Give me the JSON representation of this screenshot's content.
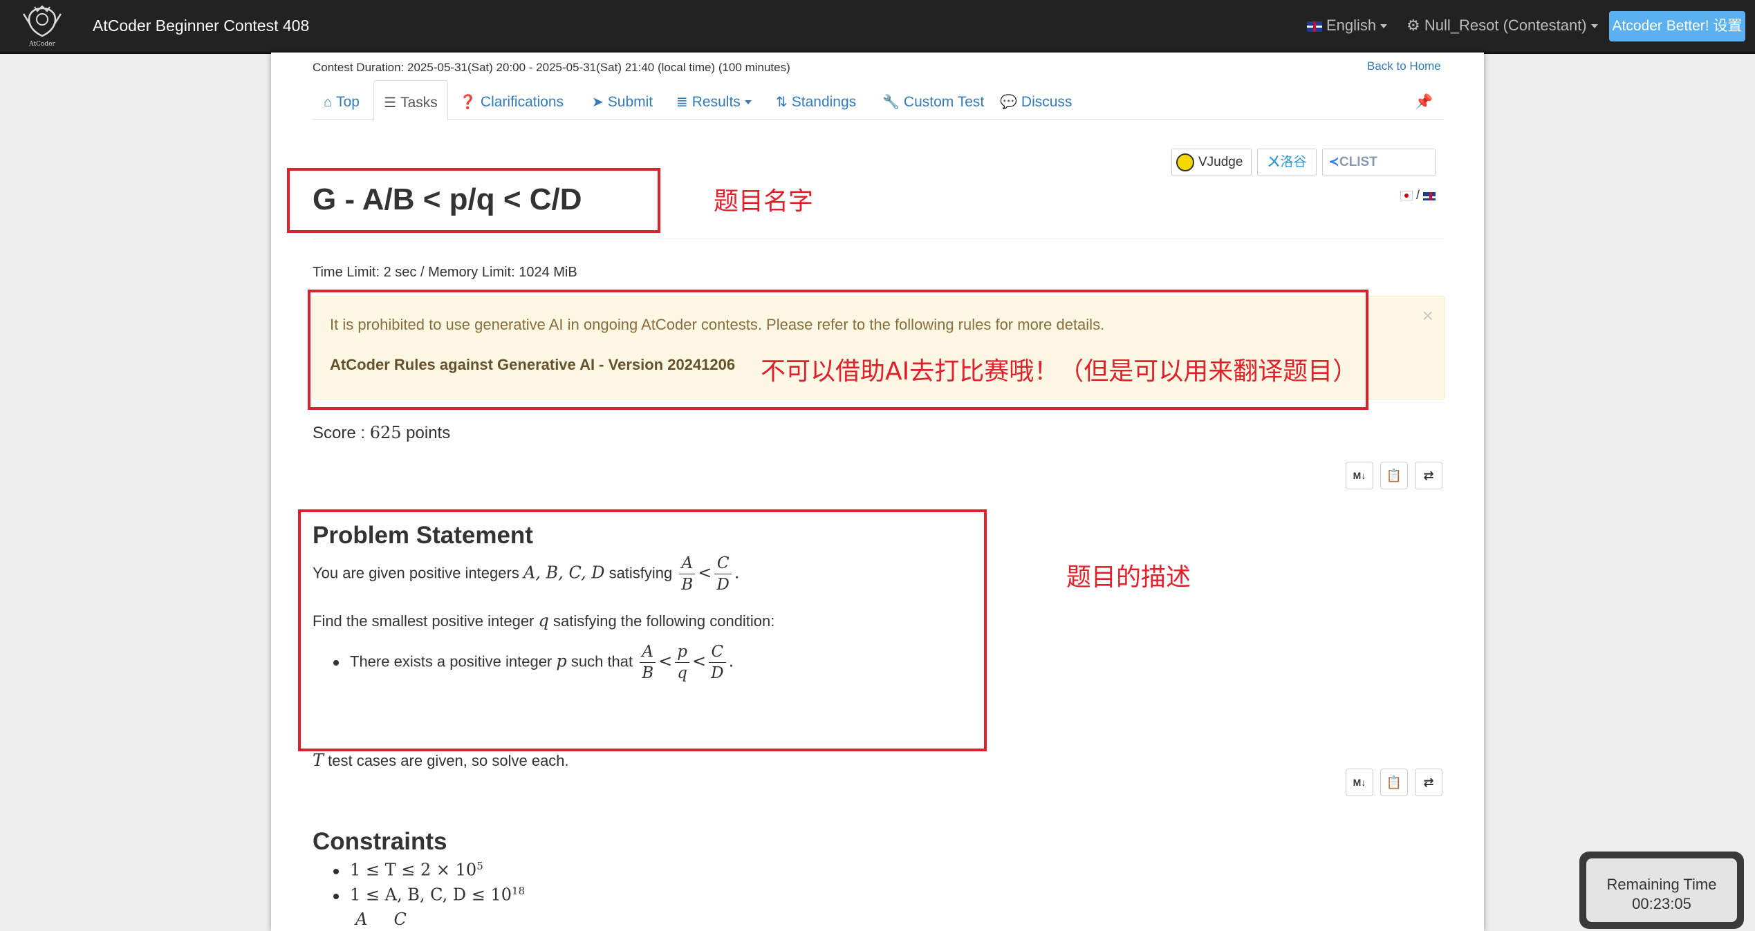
{
  "navbar": {
    "brand": "AtCoder Beginner Contest 408",
    "logo_text": "AtCoder",
    "language": "English",
    "user": "Null_Resot (Contestant)",
    "better_button": "Atcoder Better! 设置"
  },
  "contest": {
    "duration": "Contest Duration: 2025-05-31(Sat) 20:00 - 2025-05-31(Sat) 21:40 (local time) (100 minutes)",
    "back_home": "Back to Home"
  },
  "tabs": [
    {
      "label": "Top",
      "icon": "home-icon"
    },
    {
      "label": "Tasks",
      "icon": "tasks-icon",
      "active": true
    },
    {
      "label": "Clarifications",
      "icon": "question-icon"
    },
    {
      "label": "Submit",
      "icon": "send-icon"
    },
    {
      "label": "Results",
      "icon": "list-icon"
    },
    {
      "label": "Standings",
      "icon": "sort-icon"
    },
    {
      "label": "Custom Test",
      "icon": "wrench-icon"
    },
    {
      "label": "Discuss",
      "icon": "comment-icon"
    }
  ],
  "external": {
    "vjudge": "VJudge",
    "luogu": "洛谷",
    "clist": "CLIST"
  },
  "task": {
    "title": "G - A/B < p/q < C/D",
    "lang_sep": "/",
    "limits": "Time Limit: 2 sec / Memory Limit: 1024 MiB",
    "alert_text": "It is prohibited to use generative AI in ongoing AtCoder contests. Please refer to the following rules for more details.",
    "alert_rules": "AtCoder Rules against Generative AI - Version 20241206",
    "alert_close": "×",
    "score_label": "Score : ",
    "score_value": "625",
    "score_unit": " points"
  },
  "toolbar": {
    "markdown": "M↓"
  },
  "statement": {
    "heading": "Problem Statement",
    "line1_prefix": "You are given positive integers ",
    "line1_vars": "A, B, C, D",
    "line1_mid": " satisfying ",
    "line2_prefix": "Find the smallest positive integer ",
    "line2_var": "q",
    "line2_suffix": " satisfying the following condition:",
    "bullet_prefix": "There exists a positive integer ",
    "bullet_var": "p",
    "bullet_mid": " such that ",
    "line3_var": "T",
    "line3_suffix": " test cases are given, so solve each."
  },
  "constraints": {
    "heading": "Constraints",
    "item1": "1 ≤ T ≤ 2 × 10",
    "item1_exp": "5",
    "item2": "1 ≤ A, B, C, D ≤ 10",
    "item2_exp": "18",
    "item3_partial": "A     C"
  },
  "annotations": {
    "title_note": "题目名字",
    "alert_note": "不可以借助AI去打比赛哦！（但是可以用来翻译题目）",
    "statement_note": "题目的描述",
    "color": "#e0202a"
  },
  "timer": {
    "label": "Remaining Time",
    "value": "00:23:05"
  }
}
